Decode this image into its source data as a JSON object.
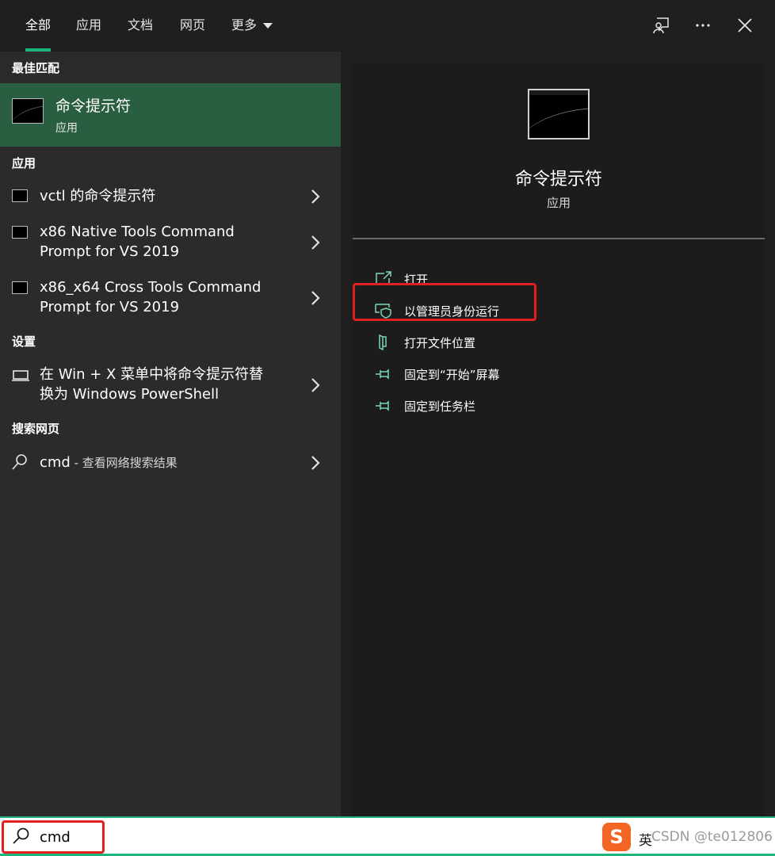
{
  "tabs": [
    {
      "label": "全部",
      "active": true
    },
    {
      "label": "应用"
    },
    {
      "label": "文档"
    },
    {
      "label": "网页"
    },
    {
      "label": "更多"
    }
  ],
  "top_icons": [
    "feedback-icon",
    "more-icon",
    "close-icon"
  ],
  "left": {
    "best_match_heading": "最佳匹配",
    "best_match": {
      "title": "命令提示符",
      "subtitle": "应用"
    },
    "apps_heading": "应用",
    "apps": [
      {
        "line1": "vctl 的命令提示符",
        "line2": ""
      },
      {
        "line1": "x86 Native Tools Command",
        "line2": "Prompt for VS 2019"
      },
      {
        "line1": "x86_x64 Cross Tools Command",
        "line2": "Prompt for VS 2019"
      }
    ],
    "settings_heading": "设置",
    "settings": [
      {
        "line1": "在 Win + X 菜单中将命令提示符替",
        "line2": "换为 Windows PowerShell"
      }
    ],
    "web_heading": "搜索网页",
    "web": {
      "query": "cmd",
      "hint": " - 查看网络搜索结果"
    }
  },
  "right": {
    "title": "命令提示符",
    "subtitle": "应用",
    "actions": [
      {
        "label": "打开",
        "icon": "open-icon"
      },
      {
        "label": "以管理员身份运行",
        "icon": "shield-icon"
      },
      {
        "label": "打开文件位置",
        "icon": "file-location-icon"
      },
      {
        "label": "固定到“开始”屏幕",
        "icon": "pin-icon"
      },
      {
        "label": "固定到任务栏",
        "icon": "pin-icon"
      }
    ]
  },
  "search": {
    "value": "cmd"
  },
  "ime": {
    "logo": "S",
    "mode": "英"
  },
  "watermark": "CSDN @te012806"
}
